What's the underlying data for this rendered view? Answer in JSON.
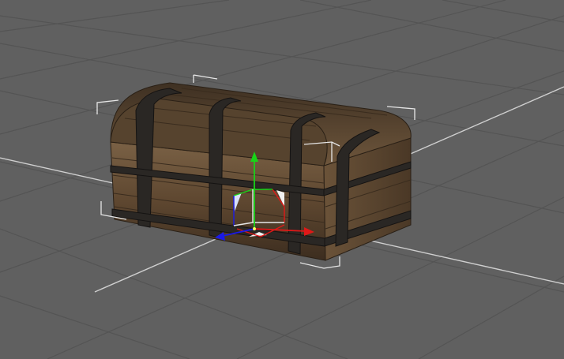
{
  "viewport": {
    "background_color": "#606060",
    "grid_color": "#535353",
    "grid_axis_color": "#cfcfcf"
  },
  "scene_object": {
    "name": "wooden-chest",
    "selected": true,
    "wood_color": "#6a5238",
    "wood_dark": "#3a2b1c",
    "band_color": "#2a2724"
  },
  "selection_bracket_color": "#e6e6e6",
  "gizmo": {
    "x_axis_color": "#e01818",
    "y_axis_color": "#18d418",
    "z_axis_color": "#1a1ae8",
    "plane_xy_color": "#f0d8d8",
    "plane_yz_color": "#d8e0f8",
    "plane_xz_color": "#f0f0f0"
  }
}
